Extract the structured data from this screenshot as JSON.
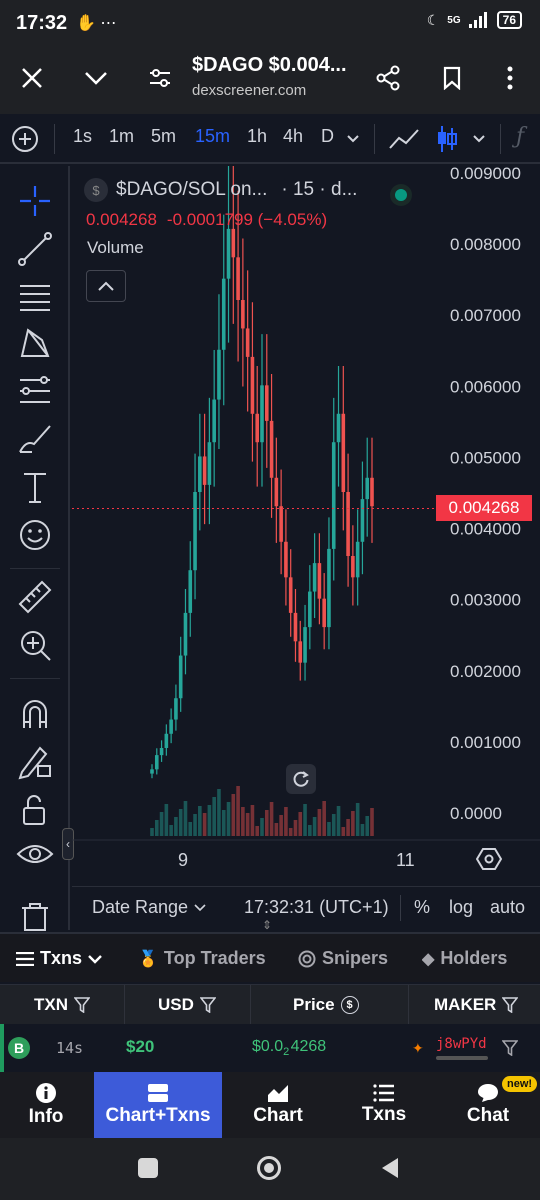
{
  "status": {
    "time": "17:32",
    "network": "5G",
    "battery": "76"
  },
  "browser": {
    "title": "$DAGO $0.004...",
    "url": "dexscreener.com"
  },
  "timeframes": [
    "1s",
    "1m",
    "5m",
    "15m",
    "1h",
    "4h",
    "D"
  ],
  "active_timeframe": "15m",
  "chart": {
    "pair_label": "$DAGO/SOL on...",
    "interval_label": "· 15 · d...",
    "price_line": "0.004268",
    "change_line": "-0.0001799 (−4.05%)",
    "volume_label": "Volume",
    "current_price_tag": "0.004268",
    "y_ticks": [
      "0.009000",
      "0.008000",
      "0.007000",
      "0.006000",
      "0.005000",
      "0.004000",
      "0.003000",
      "0.002000",
      "0.001000",
      "0.0000"
    ],
    "x_ticks": [
      "9",
      "11"
    ]
  },
  "chart_data": {
    "type": "candlestick",
    "title": "$DAGO/SOL",
    "ylim": [
      0,
      0.009
    ],
    "current_price": 0.004268,
    "close_series": [
      0.0006,
      0.0008,
      0.0009,
      0.0011,
      0.0013,
      0.0016,
      0.0022,
      0.0028,
      0.0034,
      0.0045,
      0.005,
      0.0046,
      0.0052,
      0.0058,
      0.0065,
      0.0075,
      0.0082,
      0.0078,
      0.0072,
      0.0068,
      0.0064,
      0.0056,
      0.0052,
      0.006,
      0.0055,
      0.0047,
      0.0043,
      0.0038,
      0.0033,
      0.0028,
      0.0024,
      0.0021,
      0.0026,
      0.0031,
      0.0035,
      0.003,
      0.0026,
      0.0037,
      0.0052,
      0.0056,
      0.0045,
      0.0036,
      0.0033,
      0.0038,
      0.0044,
      0.0047,
      0.0043
    ]
  },
  "chart_bottom": {
    "date_range": "Date Range",
    "clock": "17:32:31 (UTC+1)",
    "percent": "%",
    "log": "log",
    "auto": "auto"
  },
  "tabs": [
    {
      "label": "Txns",
      "active": true
    },
    {
      "label": "Top Traders",
      "active": false
    },
    {
      "label": "Snipers",
      "active": false
    },
    {
      "label": "Holders",
      "active": false
    }
  ],
  "table": {
    "headers": [
      "TXN",
      "USD",
      "Price",
      "MAKER"
    ],
    "row": {
      "type_badge": "B",
      "age": "14s",
      "usd": "$20",
      "price_main": "$0.0",
      "price_sub": "2",
      "price_tail": "4268",
      "maker": "j8wPYd"
    }
  },
  "bottom_nav": [
    {
      "label": "Info",
      "active": false
    },
    {
      "label": "Chart+Txns",
      "active": true
    },
    {
      "label": "Chart",
      "active": false
    },
    {
      "label": "Txns",
      "active": false
    },
    {
      "label": "Chat",
      "active": false,
      "badge": "new!"
    }
  ],
  "colors": {
    "up": "#26a69a",
    "down": "#ef5350",
    "accent": "#2962ff",
    "price_tag": "#f23645"
  }
}
